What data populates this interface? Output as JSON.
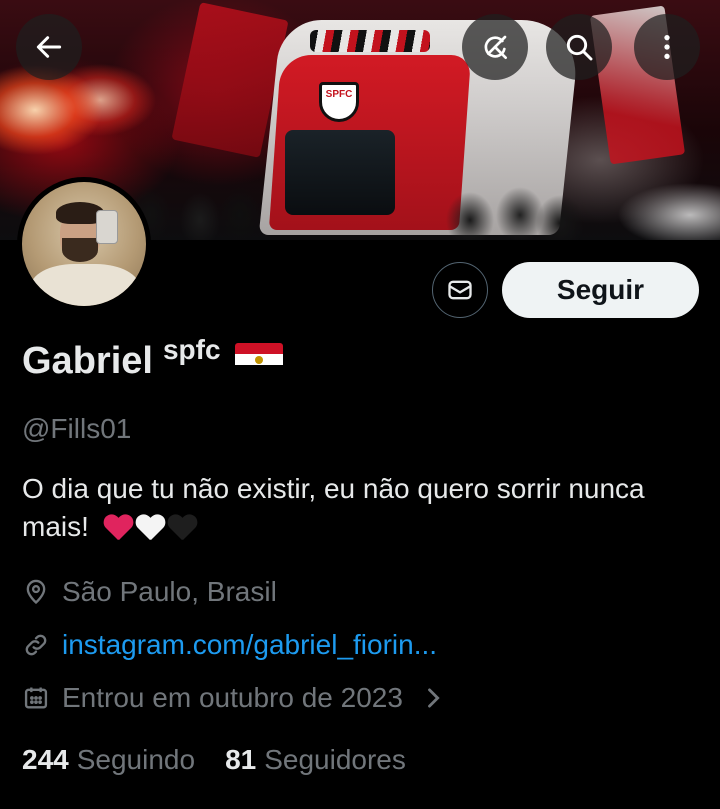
{
  "profile": {
    "name": "Gabriel",
    "name_suffix": "spfc",
    "flag_icon": "egypt-flag-icon",
    "handle": "@Fills01",
    "bio": "O dia que tu não existir, eu não quero sorrir nunca mais!",
    "bio_emojis": [
      "red-heart",
      "white-heart",
      "black-heart"
    ],
    "location": "São Paulo, Brasil",
    "link": "instagram.com/gabriel_fiorin...",
    "joined": "Entrou em outubro de 2023"
  },
  "banner": {
    "bus_badge_text": "SPFC"
  },
  "actions": {
    "follow_label": "Seguir",
    "message_icon": "envelope-icon"
  },
  "header_icons": [
    "back-arrow-icon",
    "grok-icon",
    "search-icon",
    "more-vertical-icon"
  ],
  "stats": {
    "following_count": "244",
    "following_label": "Seguindo",
    "followers_count": "81",
    "followers_label": "Seguidores"
  },
  "colors": {
    "background": "#000000",
    "text_primary": "#e7e9ea",
    "text_secondary": "#71767b",
    "link": "#1d9bf0",
    "follow_button_bg": "#eff3f4"
  }
}
